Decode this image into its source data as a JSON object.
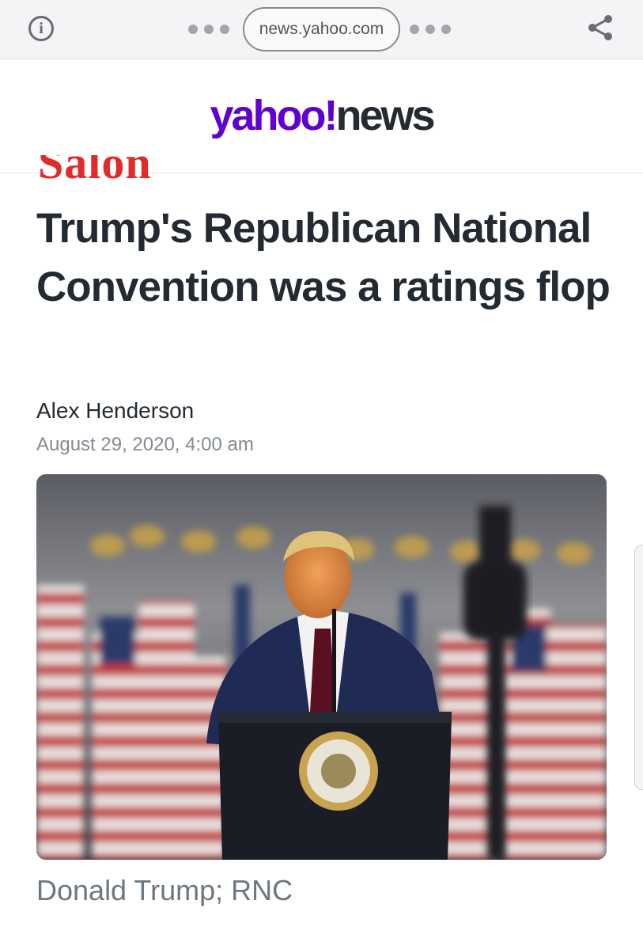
{
  "browser": {
    "url": "news.yahoo.com",
    "info_icon": "info-icon",
    "share_icon": "share-icon"
  },
  "site": {
    "logo_primary": "yahoo!",
    "logo_secondary": "news",
    "brand_color": "#6001d2"
  },
  "article": {
    "publisher": "Salon",
    "headline": "Trump's Republican National Convention was a ratings flop",
    "author": "Alex Henderson",
    "date": "August 29, 2020, 4:00 am",
    "image_caption": "Donald Trump; RNC"
  }
}
